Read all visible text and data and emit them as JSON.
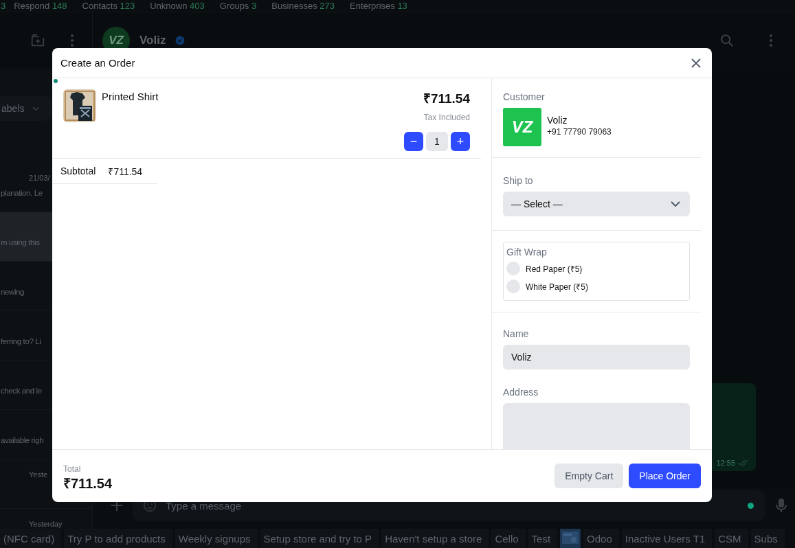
{
  "filters": [
    {
      "count": "3"
    },
    {
      "label": "Respond",
      "count": "148"
    },
    {
      "label": "Contacts",
      "count": "123"
    },
    {
      "label": "Unknown",
      "count": "403"
    },
    {
      "label": "Groups",
      "count": "3"
    },
    {
      "label": "Businesses",
      "count": "273"
    },
    {
      "label": "Enterprises",
      "count": "13"
    }
  ],
  "sidebar": {
    "label_filter": "abels",
    "chats": [
      {
        "time": "21/03/",
        "preview": "planation. Le",
        "selected": false
      },
      {
        "preview": "m using this",
        "selected": true
      },
      {
        "preview": "newing",
        "selected": false
      },
      {
        "preview": "ferring to? Li",
        "selected": false
      },
      {
        "preview": "check and le",
        "selected": false
      },
      {
        "preview": "available righ",
        "selected": false
      },
      {
        "time": "Yeste",
        "selected": false
      },
      {
        "time": "Yesterday",
        "selected": false
      }
    ]
  },
  "chat": {
    "avatar_text": "VZ",
    "contact": "Voliz",
    "verified": true,
    "message_time": "12:55",
    "message_placeholder": "Type a message"
  },
  "label_bar": [
    {
      "kind": "text",
      "label": "(NFC card)"
    },
    {
      "kind": "text",
      "label": "Try P to add products"
    },
    {
      "kind": "text",
      "label": "Weekly signups"
    },
    {
      "kind": "text",
      "label": "Setup store and try to P"
    },
    {
      "kind": "text",
      "label": "Haven't setup a store"
    },
    {
      "kind": "text",
      "label": "Cello"
    },
    {
      "kind": "text",
      "label": "Test"
    },
    {
      "kind": "picture"
    },
    {
      "kind": "text",
      "label": "Odoo"
    },
    {
      "kind": "text",
      "label": "Inactive Users T1"
    },
    {
      "kind": "text",
      "label": "CSM"
    },
    {
      "kind": "text",
      "label": "Subs"
    }
  ],
  "order_dialog": {
    "title": "Create an Order",
    "items": [
      {
        "name": "Printed Shirt",
        "price": "₹711.54",
        "tax_note": "Tax Included",
        "quantity": "1",
        "decrease": "−",
        "increase": "+"
      }
    ],
    "subtotal": {
      "label": "Subtotal",
      "value": "₹711.54"
    },
    "customer": {
      "label": "Customer",
      "avatar_text": "VZ",
      "name": "Voliz",
      "phone": "+91 77790 79063"
    },
    "ship_to": {
      "label": "Ship to",
      "value": "— Select —"
    },
    "gift_wrap": {
      "label": "Gift Wrap",
      "options": [
        {
          "label": "Red Paper (₹5)",
          "selected": false
        },
        {
          "label": "White Paper (₹5)",
          "selected": false
        }
      ]
    },
    "name": {
      "label": "Name",
      "value": "Voliz"
    },
    "address": {
      "label": "Address"
    },
    "total": {
      "label": "Total",
      "value": "₹711.54"
    },
    "buttons": [
      {
        "kind": "secondary",
        "label": "Empty Cart"
      },
      {
        "kind": "primary",
        "label": "Place Order"
      }
    ]
  }
}
